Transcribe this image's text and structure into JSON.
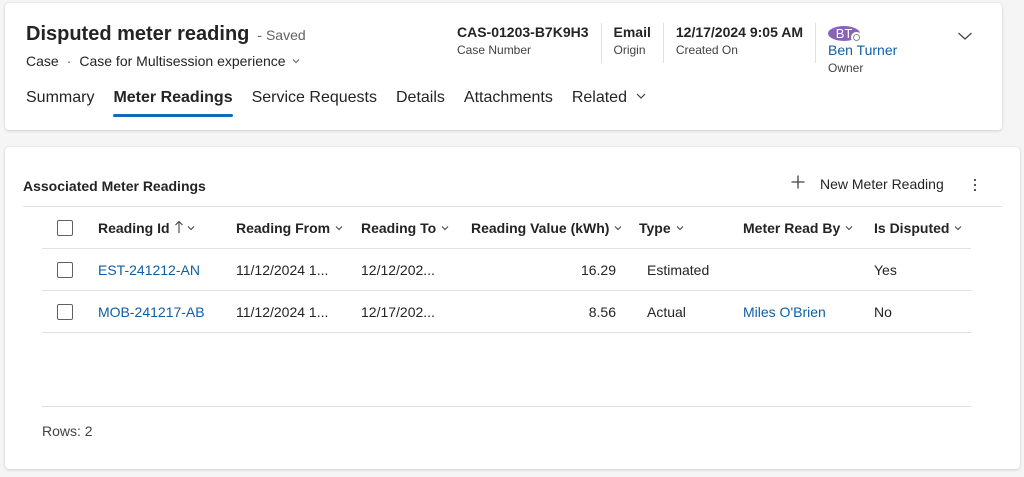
{
  "record": {
    "title": "Disputed meter reading",
    "status": "- Saved",
    "entity": "Case",
    "separator": "·",
    "form_name": "Case for Multisession experience"
  },
  "header_fields": {
    "case_number": {
      "value": "CAS-01203-B7K9H3",
      "label": "Case Number"
    },
    "origin": {
      "value": "Email",
      "label": "Origin"
    },
    "created_on": {
      "value": "12/17/2024 9:05 AM",
      "label": "Created On"
    },
    "owner": {
      "initials": "BT",
      "name": "Ben Turner",
      "label": "Owner"
    }
  },
  "tabs": [
    {
      "label": "Summary"
    },
    {
      "label": "Meter Readings"
    },
    {
      "label": "Service Requests"
    },
    {
      "label": "Details"
    },
    {
      "label": "Attachments"
    },
    {
      "label": "Related"
    }
  ],
  "active_tab": "Meter Readings",
  "grid": {
    "title": "Associated Meter Readings",
    "new_button": "New Meter Reading",
    "columns": [
      {
        "label": "Reading Id",
        "sort": "ascending"
      },
      {
        "label": "Reading From"
      },
      {
        "label": "Reading To"
      },
      {
        "label": "Reading Value (kWh)"
      },
      {
        "label": "Type"
      },
      {
        "label": "Meter Read By"
      },
      {
        "label": "Is Disputed"
      }
    ],
    "rows": [
      {
        "id": "EST-241212-AN",
        "from": "11/12/2024 1...",
        "to": "12/12/202...",
        "value": "16.29",
        "type": "Estimated",
        "read_by": "",
        "disputed": "Yes"
      },
      {
        "id": "MOB-241217-AB",
        "from": "11/12/2024 1...",
        "to": "12/17/202...",
        "value": "8.56",
        "type": "Actual",
        "read_by": "Miles O'Brien",
        "disputed": "No"
      }
    ],
    "rows_label": "Rows: 2"
  },
  "colors": {
    "accent": "#0f6cbd",
    "link": "#115ea3",
    "avatar": "#8764b8"
  },
  "icons": [
    "chevron-down-icon",
    "sort-ascending-icon",
    "plus-icon",
    "more-vertical-icon",
    "presence-offline-icon"
  ]
}
